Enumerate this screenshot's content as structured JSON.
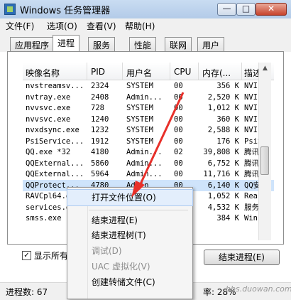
{
  "window": {
    "title": "Windows 任务管理器",
    "min_glyph": "—",
    "max_glyph": "□",
    "close_glyph": "✕"
  },
  "menubar": [
    "文件(F)",
    "选项(O)",
    "查看(V)",
    "帮助(H)"
  ],
  "tabs": [
    "应用程序",
    "进程",
    "服务",
    "性能",
    "联网",
    "用户"
  ],
  "active_tab": "进程",
  "table": {
    "columns": [
      "映像名称",
      "PID",
      "用户名",
      "CPU",
      "内存(...",
      "描述"
    ],
    "rows": [
      {
        "name": "nvstreamsv...",
        "pid": "2324",
        "user": "SYSTEM",
        "cpu": "00",
        "mem": "356 K",
        "desc": "NVI"
      },
      {
        "name": "nvtray.exe",
        "pid": "2408",
        "user": "Admin...",
        "cpu": "00",
        "mem": "2,520 K",
        "desc": "NVI"
      },
      {
        "name": "nvvsvc.exe",
        "pid": "728",
        "user": "SYSTEM",
        "cpu": "00",
        "mem": "1,012 K",
        "desc": "NVI"
      },
      {
        "name": "nvvsvc.exe",
        "pid": "1240",
        "user": "SYSTEM",
        "cpu": "00",
        "mem": "360 K",
        "desc": "NVI"
      },
      {
        "name": "nvxdsync.exe",
        "pid": "1232",
        "user": "SYSTEM",
        "cpu": "00",
        "mem": "2,588 K",
        "desc": "NVI"
      },
      {
        "name": "PsiService...",
        "pid": "1912",
        "user": "SYSTEM",
        "cpu": "00",
        "mem": "176 K",
        "desc": "PsiS"
      },
      {
        "name": "QQ.exe *32",
        "pid": "4180",
        "user": "Admin...",
        "cpu": "02",
        "mem": "39,808 K",
        "desc": "腾讯"
      },
      {
        "name": "QQExternal...",
        "pid": "5860",
        "user": "Admin...",
        "cpu": "00",
        "mem": "6,752 K",
        "desc": "腾讯"
      },
      {
        "name": "QQExternal...",
        "pid": "5964",
        "user": "Admin...",
        "cpu": "00",
        "mem": "11,716 K",
        "desc": "腾讯"
      },
      {
        "name": "QQProtect...",
        "pid": "4780",
        "user": "Admin",
        "cpu": "00",
        "mem": "6,140 K",
        "desc": "QQ安"
      },
      {
        "name": "RAVCpl64.e",
        "pid": "",
        "user": "",
        "cpu": "",
        "mem": "1,052 K",
        "desc": "Rea"
      },
      {
        "name": "services.e",
        "pid": "",
        "user": "",
        "cpu": "",
        "mem": "4,532 K",
        "desc": "服务"
      },
      {
        "name": "smss.exe",
        "pid": "",
        "user": "",
        "cpu": "",
        "mem": "384 K",
        "desc": "Win"
      }
    ]
  },
  "context_menu": {
    "items": [
      {
        "label": "打开文件位置(O)",
        "enabled": true,
        "highlighted": true
      },
      {
        "label": "结束进程(E)",
        "enabled": true
      },
      {
        "label": "结束进程树(T)",
        "enabled": true
      },
      {
        "label": "调试(D)",
        "enabled": false
      },
      {
        "label": "UAC 虚拟化(V)",
        "enabled": false
      },
      {
        "label": "创建转储文件(C)",
        "enabled": true
      }
    ]
  },
  "show_all": {
    "label": "显示所有",
    "checked": true,
    "check_glyph": "✓"
  },
  "end_process_button": "结束进程(E)",
  "status": {
    "process_count": "进程数: 67",
    "tail": "率: 28%"
  },
  "scrollbar": {
    "up_glyph": "▲"
  },
  "watermark": "bbs.duowan.com",
  "colors": {
    "selected_row": "#cfe4fb",
    "arrow": "#e8302a",
    "menu_highlight": "#e3eefc"
  }
}
